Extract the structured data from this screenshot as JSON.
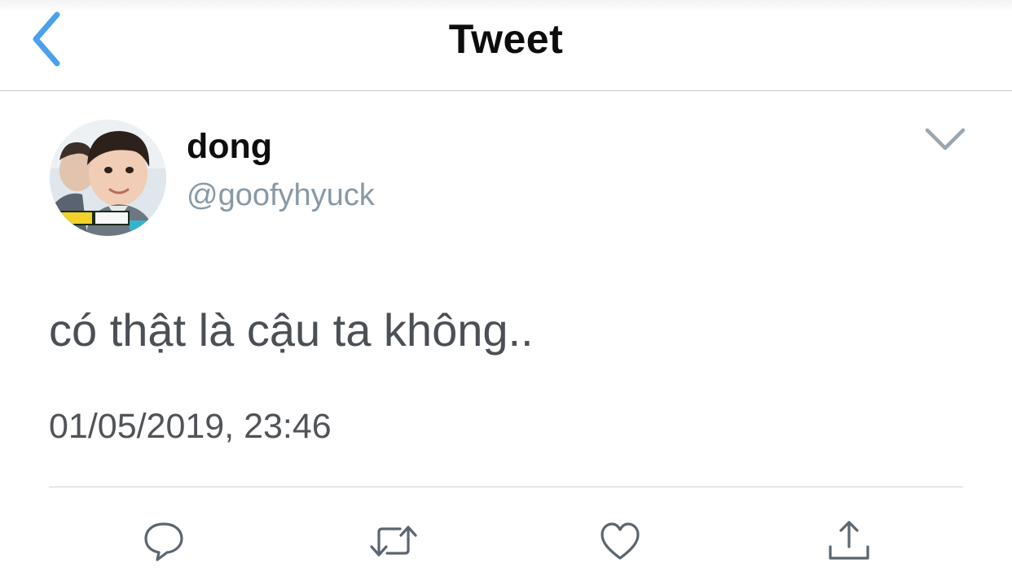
{
  "nav": {
    "title": "Tweet",
    "back_icon": "chevron-left-icon"
  },
  "tweet": {
    "author": {
      "display_name": "dong",
      "username": "@goofyhyuck",
      "avatar": "avatar-photo"
    },
    "text": "có thật là cậu ta không..",
    "timestamp": "01/05/2019, 23:46",
    "menu_icon": "chevron-down-icon"
  },
  "actions": [
    {
      "name": "reply",
      "icon": "reply-icon"
    },
    {
      "name": "retweet",
      "icon": "retweet-icon"
    },
    {
      "name": "like",
      "icon": "heart-icon"
    },
    {
      "name": "share",
      "icon": "share-icon"
    }
  ],
  "colors": {
    "accent": "#4aa1ec",
    "secondary_text": "#8899a6",
    "icon_gray": "#5b6670"
  }
}
